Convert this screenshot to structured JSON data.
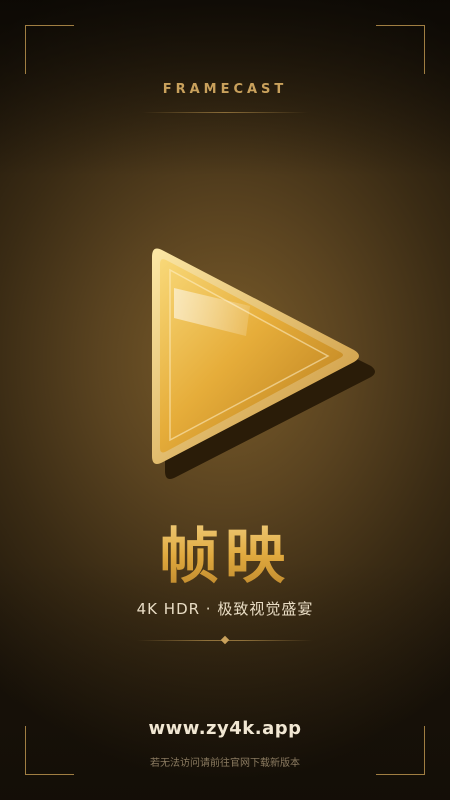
{
  "brand": {
    "name_en": "FRAMECAST"
  },
  "app": {
    "name": "帧映",
    "tagline": "4K HDR · 极致视觉盛宴"
  },
  "footer": {
    "url": "www.zy4k.app",
    "fallback_text": "若无法访问请前往官网下载新版本"
  },
  "icons": {
    "logo": "play-triangle-logo"
  },
  "colors": {
    "gold_accent": "#c9a15c",
    "gold_bright": "#f3d58c",
    "gold_deep": "#b9832a",
    "background_dark": "#1a1309"
  }
}
